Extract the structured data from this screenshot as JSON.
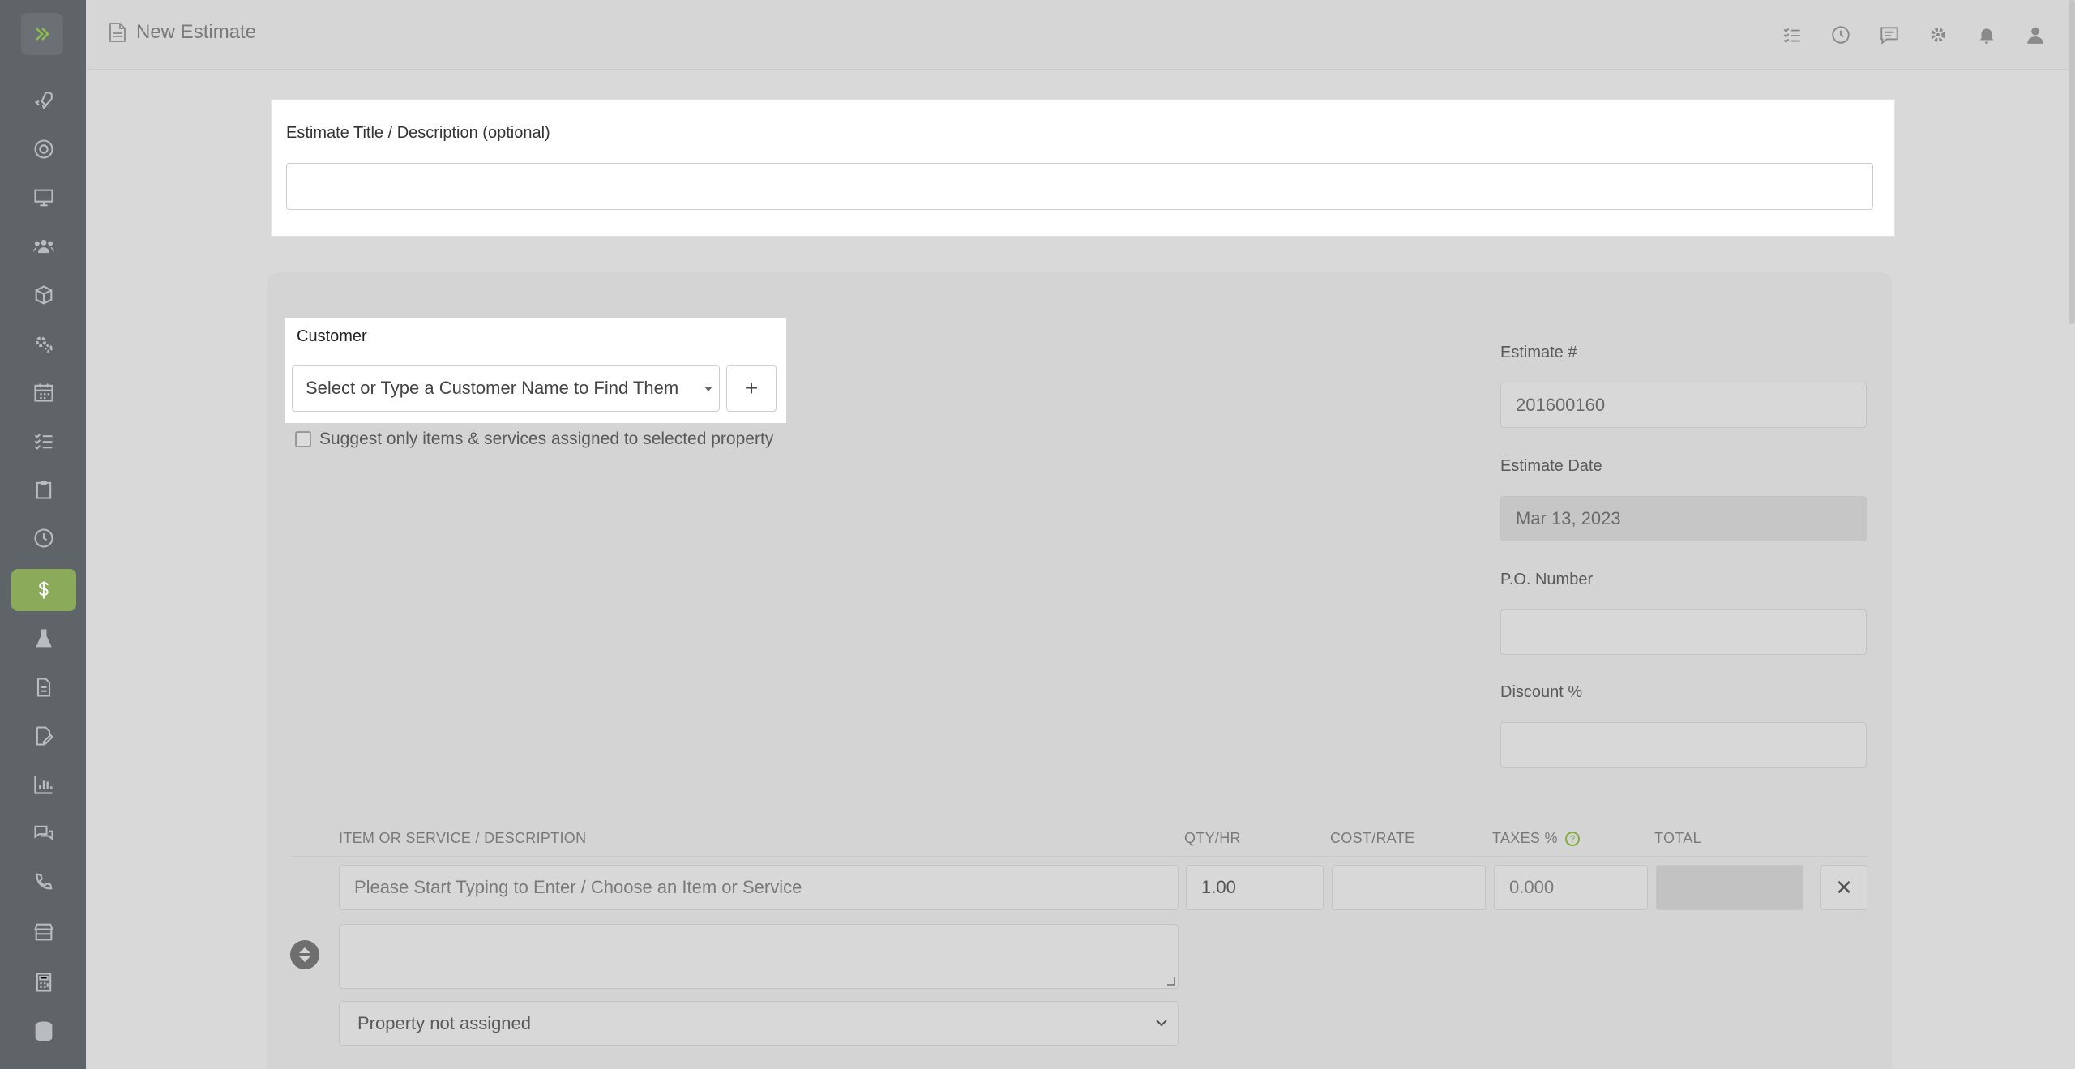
{
  "header": {
    "page_title": "New Estimate"
  },
  "title_card": {
    "label": "Estimate Title / Description (optional)",
    "value": ""
  },
  "customer": {
    "label": "Customer",
    "select_placeholder": "Select or Type a Customer Name to Find Them",
    "add_label": "+",
    "suggest_label": "Suggest only items & services assigned to selected property"
  },
  "estimate_fields": {
    "estimate_number_label": "Estimate #",
    "estimate_number_value": "201600160",
    "estimate_date_label": "Estimate Date",
    "estimate_date_value": "Mar 13, 2023",
    "po_number_label": "P.O. Number",
    "po_number_value": "",
    "discount_label": "Discount %",
    "discount_value": ""
  },
  "items_table": {
    "columns": [
      "ITEM OR SERVICE / DESCRIPTION",
      "QTY/HR",
      "COST/RATE",
      "TAXES %",
      "TOTAL"
    ],
    "taxes_help": "?",
    "row": {
      "item_placeholder": "Please Start Typing to Enter / Choose an Item or Service",
      "qty": "1.00",
      "cost": "",
      "taxes_placeholder": "0.000",
      "total": "",
      "remove_label": "✕",
      "property_select": "Property not assigned"
    }
  },
  "sidebar": {
    "items": [
      "rocket-icon",
      "lifebuoy-icon",
      "monitor-icon",
      "users-icon",
      "box-icon",
      "gears-icon",
      "calendar-icon",
      "list-icon",
      "clipboard-icon",
      "clock-icon",
      "dollar-icon",
      "flask-icon",
      "document-icon",
      "signature-icon",
      "chart-icon",
      "comments-icon",
      "phone-icon",
      "store-icon",
      "calculator-icon",
      "database-icon"
    ],
    "active": "dollar-icon"
  },
  "colors": {
    "accent": "#8cab5a",
    "sidebar_bg": "#5f6469"
  }
}
